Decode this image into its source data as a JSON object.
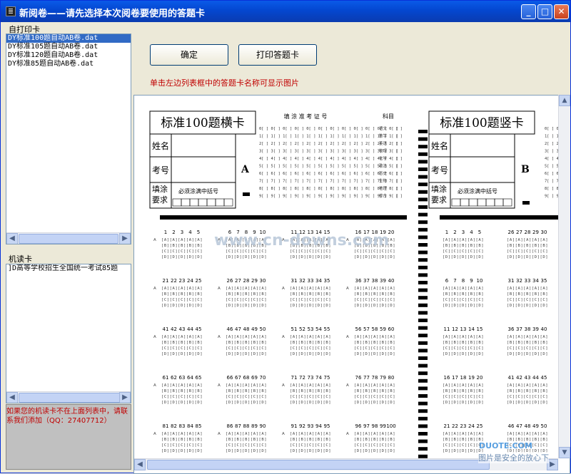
{
  "window": {
    "title": "新阅卷——请先选择本次阅卷要使用的答题卡"
  },
  "colors": {
    "titlebar": "#0a5ae8",
    "selection": "#316ac5",
    "hint_red": "#c00000"
  },
  "self_print": {
    "label": "自打印卡",
    "items": [
      "DY标准100题自动AB卷.dat",
      "DY标准105题自动AB卷.dat",
      "DY标准120题自动AB卷.dat",
      "DY标准85题自动AB卷.dat"
    ],
    "selected_index": 0
  },
  "machine_read": {
    "label": "机读卡",
    "items": [
      "]D高等学校招生全国统一考试85题"
    ]
  },
  "buttons": {
    "confirm": "确定",
    "print_card": "打印答题卡"
  },
  "hint": "单击左边列表框中的答题卡名称可显示图片",
  "notice": "如果您的机读卡不在上面列表中，请联系我们添加（QQ：27407712）",
  "preview": {
    "card_a_title": "标准100题横卡",
    "card_b_title": "标准100题竖卡",
    "name_label": "姓名",
    "id_label": "考号",
    "fill_label": "填涂要求",
    "fill_note": "必须涂满中括号",
    "exam_number_title": "填 涂 准 考 证 号",
    "subject_title": "科目",
    "subjects": [
      "语文",
      "数学",
      "英语",
      "物理",
      "化学",
      "政治",
      "历史",
      "生物",
      "地理",
      "综合"
    ],
    "mark_a": "A",
    "mark_b": "B",
    "question_blocks_left": [
      [
        [
          1,
          2,
          3,
          4,
          5
        ],
        [
          6,
          7,
          8,
          9,
          10
        ],
        [
          11,
          12,
          13,
          14,
          15
        ],
        [
          16,
          17,
          18,
          19,
          20
        ]
      ],
      [
        [
          21,
          22,
          23,
          24,
          25
        ],
        [
          26,
          27,
          28,
          29,
          30
        ],
        [
          31,
          32,
          33,
          34,
          35
        ],
        [
          36,
          37,
          38,
          39,
          40
        ]
      ],
      [
        [
          41,
          42,
          43,
          44,
          45
        ],
        [
          46,
          47,
          48,
          49,
          50
        ],
        [
          51,
          52,
          53,
          54,
          55
        ],
        [
          56,
          57,
          58,
          59,
          60
        ]
      ],
      [
        [
          61,
          62,
          63,
          64,
          65
        ],
        [
          66,
          67,
          68,
          69,
          70
        ],
        [
          71,
          72,
          73,
          74,
          75
        ],
        [
          76,
          77,
          78,
          79,
          80
        ]
      ],
      [
        [
          81,
          82,
          83,
          84,
          85
        ],
        [
          86,
          87,
          88,
          89,
          90
        ],
        [
          91,
          92,
          93,
          94,
          95
        ],
        [
          96,
          97,
          98,
          99,
          100
        ]
      ]
    ],
    "question_blocks_right": [
      [
        [
          1,
          2,
          3,
          4,
          5
        ],
        [
          26,
          27,
          28,
          29,
          30
        ]
      ],
      [
        [
          6,
          7,
          8,
          9,
          10
        ],
        [
          31,
          32,
          33,
          34,
          35
        ]
      ],
      [
        [
          11,
          12,
          13,
          14,
          15
        ],
        [
          36,
          37,
          38,
          39,
          40
        ]
      ],
      [
        [
          16,
          17,
          18,
          19,
          20
        ],
        [
          41,
          42,
          43,
          44,
          45
        ]
      ],
      [
        [
          21,
          22,
          23,
          24,
          25
        ],
        [
          46,
          47,
          48,
          49,
          50
        ]
      ]
    ],
    "options": [
      "A",
      "B",
      "C",
      "D"
    ],
    "watermark": "www.cn-downs.com"
  },
  "corner_tag": {
    "brand": "DUOTE.COM",
    "caption": "图片是安全的放心下"
  }
}
